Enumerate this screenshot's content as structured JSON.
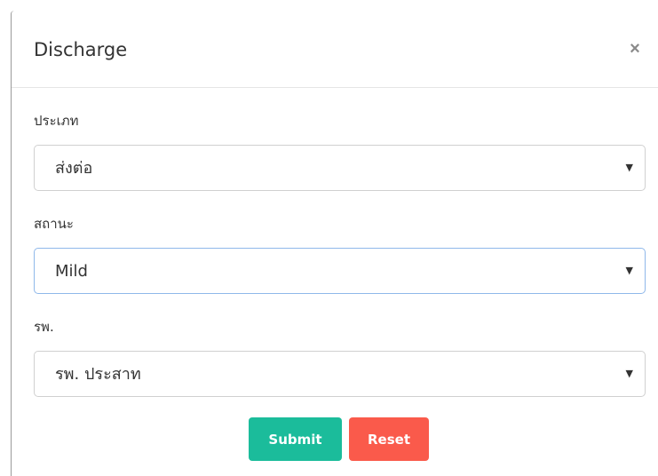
{
  "modal": {
    "title": "Discharge",
    "close_label": "×"
  },
  "form": {
    "type_field": {
      "label": "ประเภท",
      "selected": "ส่งต่อ"
    },
    "status_field": {
      "label": "สถานะ",
      "selected": "Mild"
    },
    "hospital_field": {
      "label": "รพ.",
      "selected": "รพ. ประสาท"
    }
  },
  "actions": {
    "submit_label": "Submit",
    "reset_label": "Reset"
  },
  "colors": {
    "submit": "#1bbc9b",
    "reset": "#fa5a4b",
    "focus_border": "#8fb8ea"
  }
}
